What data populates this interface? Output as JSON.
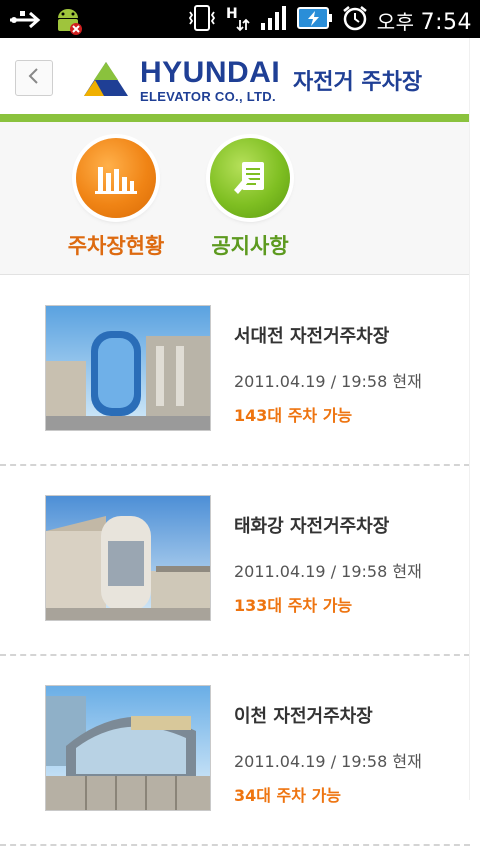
{
  "status_bar": {
    "icons_left": [
      "usb-icon",
      "android-debug-icon"
    ],
    "icons_right": [
      "vibrate-icon",
      "hsdpa-icon",
      "signal-icon",
      "battery-charging-icon",
      "alarm-icon"
    ],
    "ampm": "오후",
    "time": "7:54"
  },
  "header": {
    "brand_main": "HYUNDAI",
    "brand_sub": "ELEVATOR CO., LTD.",
    "title": "자전거 주차장",
    "accent_color": "#8ac23d"
  },
  "menu": [
    {
      "label": "주차장현황",
      "icon": "bar-chart-icon",
      "color": "#f08415"
    },
    {
      "label": "공지사항",
      "icon": "notice-document-icon",
      "color": "#7fbf22"
    }
  ],
  "parking_lots": [
    {
      "name": "서대전 자전거주차장",
      "date": "2011.04.19 / 19:58 현재",
      "availability": "143대 주차 가능"
    },
    {
      "name": "태화강 자전거주차장",
      "date": "2011.04.19 / 19:58 현재",
      "availability": "133대 주차 가능"
    },
    {
      "name": "이천 자전거주차장",
      "date": "2011.04.19 / 19:58 현재",
      "availability": "34대 주차 가능"
    }
  ]
}
